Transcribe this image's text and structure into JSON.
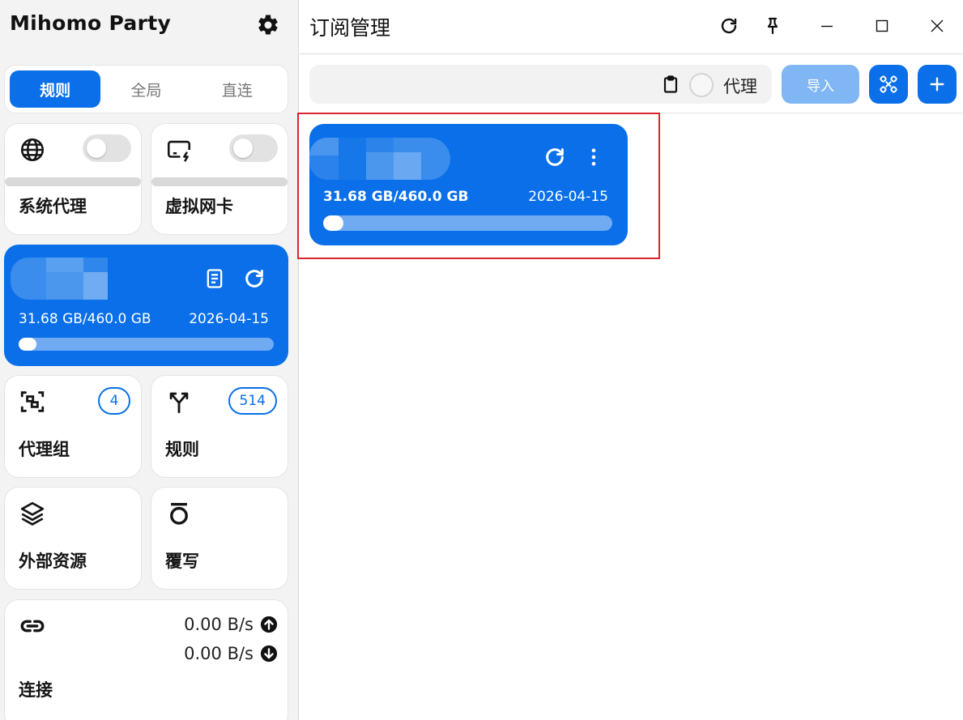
{
  "app": {
    "name": "Mihomo Party"
  },
  "sidebar": {
    "mode_tabs": [
      {
        "label": "规则",
        "active": true
      },
      {
        "label": "全局",
        "active": false
      },
      {
        "label": "直连",
        "active": false
      }
    ],
    "system_proxy": {
      "label": "系统代理",
      "icon": "globe-icon",
      "enabled": false
    },
    "virtual_nic": {
      "label": "虚拟网卡",
      "icon": "network-card-icon",
      "enabled": false
    },
    "profile": {
      "usage": "31.68 GB/460.0 GB",
      "expire": "2026-04-15",
      "progress_percent": 6.9
    },
    "proxy_groups": {
      "label": "代理组",
      "count": "4",
      "icon": "proxy-group-icon"
    },
    "rules": {
      "label": "规则",
      "count": "514",
      "icon": "rule-fork-icon"
    },
    "resources": {
      "label": "外部资源",
      "icon": "layers-icon"
    },
    "override": {
      "label": "覆写",
      "icon": "override-icon"
    },
    "connections": {
      "label": "连接",
      "icon": "link-icon",
      "upload": "0.00 B/s",
      "download": "0.00 B/s"
    }
  },
  "main": {
    "title": "订阅管理",
    "toolbar": {
      "url_value": "",
      "proxy_label": "代理",
      "proxy_checked": false,
      "import_label": "导入"
    },
    "subscriptions": [
      {
        "usage": "31.68 GB/460.0 GB",
        "expire": "2026-04-15",
        "progress_percent": 6.9,
        "selected": true
      }
    ]
  },
  "colors": {
    "accent": "#0a6fe8",
    "accent_light": "#80b6f3",
    "highlight": "#d9262e"
  }
}
